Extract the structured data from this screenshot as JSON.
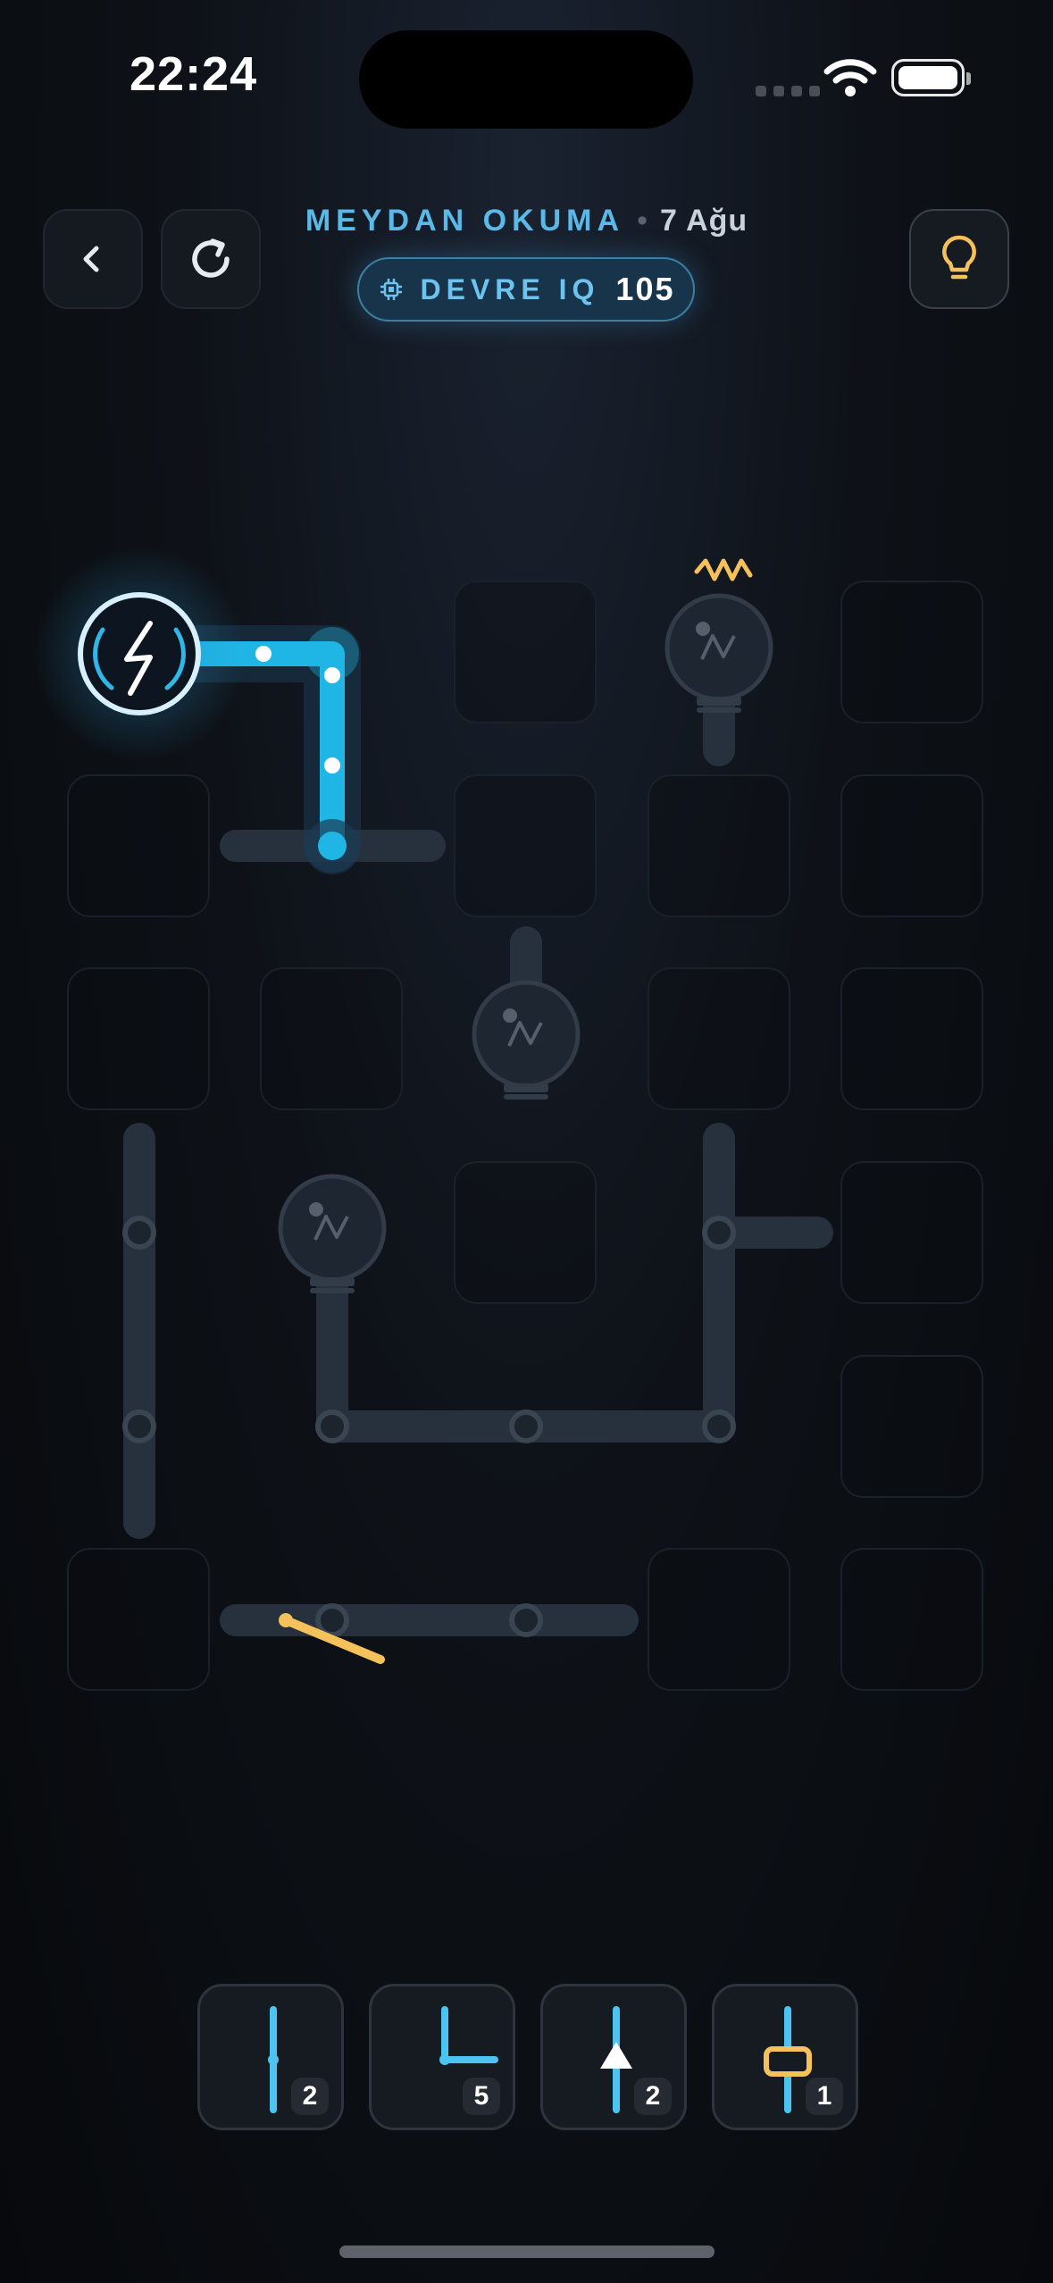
{
  "status_bar": {
    "time": "22:24"
  },
  "header": {
    "mode": "MEYDAN OKUMA",
    "date": "7 Ağu",
    "iq_label": "DEVRE IQ",
    "iq_value": "105",
    "back_icon": "chevron-left-icon",
    "restart_icon": "restart-icon",
    "hint_icon": "lightbulb-icon"
  },
  "colors": {
    "background": "#0b0e13",
    "powered_wire": "#1fb6e6",
    "unpowered_wire": "#27313e",
    "accent_text": "#5ab9e8",
    "hint": "#f5c15a"
  },
  "tray": [
    {
      "piece": "straight",
      "count": "2"
    },
    {
      "piece": "corner",
      "count": "5"
    },
    {
      "piece": "diode",
      "count": "2"
    },
    {
      "piece": "resistor",
      "count": "1"
    }
  ]
}
